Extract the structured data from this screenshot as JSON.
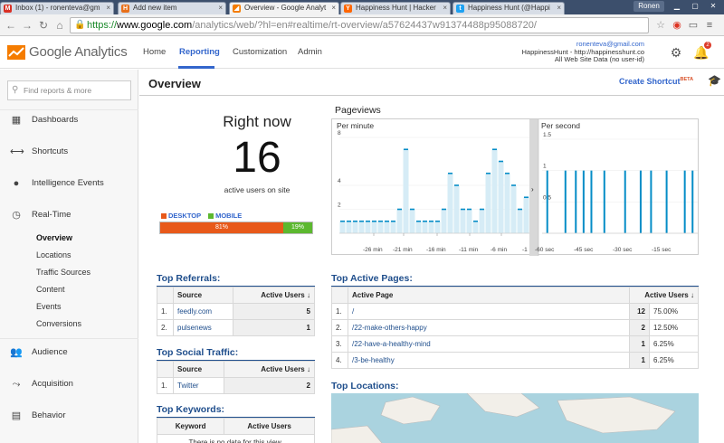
{
  "browser": {
    "tabs": [
      {
        "label": "Inbox (1) - ronenteva@gm",
        "favicon": "M",
        "color": "#d93025"
      },
      {
        "label": "Add new item",
        "favicon": "H",
        "color": "#e8701a"
      },
      {
        "label": "Overview - Google Analyt",
        "favicon": "◢",
        "color": "#f57c00"
      },
      {
        "label": "Happiness Hunt | Hacker",
        "favicon": "Y",
        "color": "#ff6600"
      },
      {
        "label": "Happiness Hunt (@Happi",
        "favicon": "t",
        "color": "#1da1f2"
      }
    ],
    "user": "Ronen",
    "url": {
      "proto": "https://",
      "host": "www.google.com",
      "path": "/analytics/web/?hl=en#realtime/rt-overview/a57624437w91374488p95088720/"
    }
  },
  "header": {
    "logo_text": "Google Analytics",
    "nav": [
      "Home",
      "Reporting",
      "Customization",
      "Admin"
    ],
    "account": {
      "email": "ronenteva@gmail.com",
      "property": "HappinessHunt - http://happinesshunt.co",
      "view": "All Web Site Data (no user-id)"
    },
    "notifications": "2"
  },
  "sidebar": {
    "search_placeholder": "Find reports & more",
    "items": [
      {
        "label": "Dashboards",
        "icon": "grid-icon",
        "glyph": "▦"
      },
      {
        "label": "Shortcuts",
        "icon": "shortcut-arrow-icon",
        "glyph": "⟷"
      },
      {
        "label": "Intelligence Events",
        "icon": "lightbulb-icon",
        "glyph": "💡"
      },
      {
        "label": "Real-Time",
        "icon": "clock-icon",
        "glyph": "◷"
      }
    ],
    "realtime_sub": [
      "Overview",
      "Locations",
      "Traffic Sources",
      "Content",
      "Events",
      "Conversions"
    ],
    "bottom_items": [
      {
        "label": "Audience",
        "icon": "people-icon",
        "glyph": "👥"
      },
      {
        "label": "Acquisition",
        "icon": "acquisition-icon",
        "glyph": "⤳"
      },
      {
        "label": "Behavior",
        "icon": "behavior-icon",
        "glyph": "▤"
      }
    ]
  },
  "main": {
    "title": "Overview",
    "create_shortcut": "Create Shortcut",
    "beta": "BETA",
    "right_now": "Right now",
    "active_users": "16",
    "active_label": "active users on site",
    "devices": {
      "desktop_label": "DESKTOP",
      "mobile_label": "MOBILE",
      "desktop_pct": 81,
      "mobile_pct": 19,
      "desktop_text": "81%",
      "mobile_text": "19%",
      "desktop_color": "#e8591a",
      "mobile_color": "#5cb82f"
    },
    "pageviews_title": "Pageviews",
    "per_minute_label": "Per minute",
    "per_second_label": "Per second",
    "top_referrals": {
      "title": "Top Referrals:",
      "headers": [
        "Source",
        "Active Users"
      ],
      "rows": [
        {
          "idx": "1.",
          "source": "feedly.com",
          "users": "5"
        },
        {
          "idx": "2.",
          "source": "pulsenews",
          "users": "1"
        }
      ]
    },
    "top_social": {
      "title": "Top Social Traffic:",
      "headers": [
        "Source",
        "Active Users"
      ],
      "rows": [
        {
          "idx": "1.",
          "source": "Twitter",
          "users": "2"
        }
      ]
    },
    "top_keywords": {
      "title": "Top Keywords:",
      "headers": [
        "Keyword",
        "Active Users"
      ],
      "empty": "There is no data for this view."
    },
    "top_pages": {
      "title": "Top Active Pages:",
      "headers": [
        "Active Page",
        "Active Users"
      ],
      "rows": [
        {
          "idx": "1.",
          "page": "/",
          "users": "12",
          "pct": "75.00%"
        },
        {
          "idx": "2.",
          "page": "/22-make-others-happy",
          "users": "2",
          "pct": "12.50%"
        },
        {
          "idx": "3.",
          "page": "/22-have-a-healthy-mind",
          "users": "1",
          "pct": "6.25%"
        },
        {
          "idx": "4.",
          "page": "/3-be-healthy",
          "users": "1",
          "pct": "6.25%"
        }
      ]
    },
    "top_locations": {
      "title": "Top Locations:"
    }
  },
  "chart_data": [
    {
      "type": "bar",
      "title": "Per minute",
      "x": [
        -30,
        -29,
        -28,
        -27,
        -26,
        -25,
        -24,
        -23,
        -22,
        -21,
        -20,
        -19,
        -18,
        -17,
        -16,
        -15,
        -14,
        -13,
        -12,
        -11,
        -10,
        -9,
        -8,
        -7,
        -6,
        -5,
        -4,
        -3,
        -2,
        -1
      ],
      "values": [
        1,
        1,
        1,
        1,
        1,
        1,
        1,
        1,
        1,
        2,
        7,
        2,
        1,
        1,
        1,
        1,
        2,
        5,
        4,
        2,
        2,
        1,
        2,
        5,
        7,
        6,
        5,
        4,
        2,
        3
      ],
      "x_tick_labels": [
        "-26 min",
        "-21 min",
        "-16 min",
        "-11 min",
        "-6 min",
        "-1"
      ],
      "y_tick_labels": [
        "8",
        "4",
        "2"
      ],
      "ylim": [
        0,
        8
      ],
      "color": "#058dc7"
    },
    {
      "type": "bar",
      "title": "Per second",
      "x_tick_labels": [
        "-60 sec",
        "-45 sec",
        "-30 sec",
        "-15 sec"
      ],
      "y_tick_labels": [
        "1.5",
        "1",
        "0.5"
      ],
      "ylim": [
        0,
        1.5
      ],
      "spikes_sec": [
        -58,
        -51,
        -47,
        -44,
        -41,
        -36,
        -28,
        -22,
        -18,
        -12,
        -5,
        -2
      ],
      "values": [
        1,
        1,
        1,
        1,
        1,
        1,
        1,
        1,
        1,
        1,
        1,
        1
      ],
      "color": "#058dc7"
    }
  ]
}
